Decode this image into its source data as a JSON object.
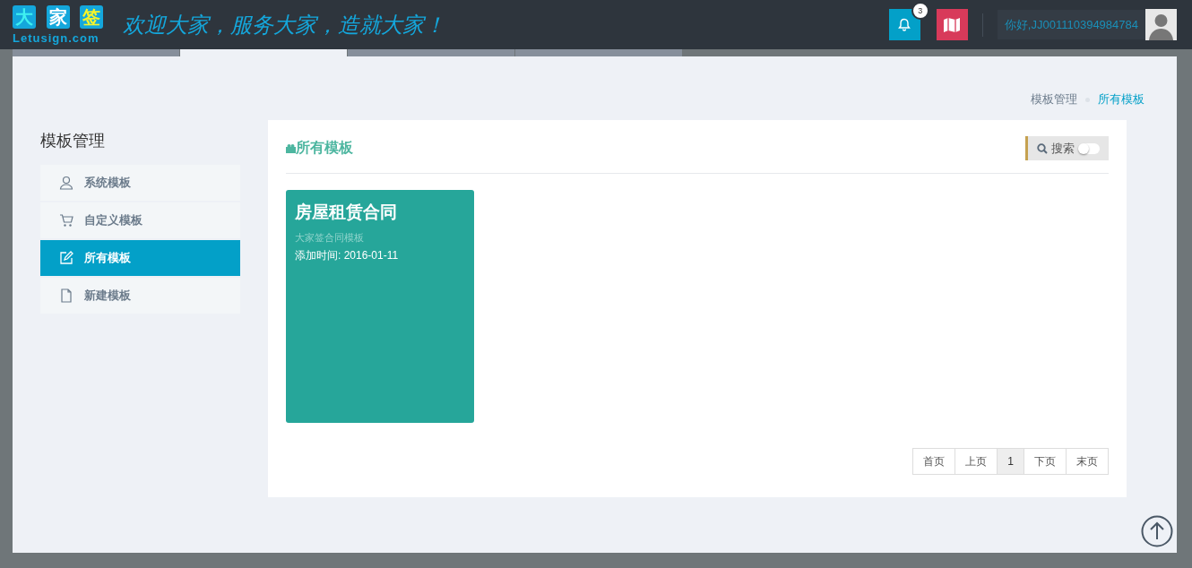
{
  "header": {
    "logo_chars": [
      "大",
      "家",
      "签"
    ],
    "logo_domain": "Letusign.com",
    "slogan": "欢迎大家，服务大家，造就大家！",
    "notification_count": "3",
    "greeting": "你好,JJ001110394984784"
  },
  "top_tabs": [
    {
      "selected": false
    },
    {
      "selected": true
    },
    {
      "selected": false
    },
    {
      "selected": false
    }
  ],
  "breadcrumb": [
    {
      "label": "模板管理",
      "selected": false
    },
    {
      "label": "所有模板",
      "selected": true
    }
  ],
  "sidebar": {
    "title": "模板管理",
    "items": [
      {
        "label": "系统模板",
        "kind": "user",
        "selected": false
      },
      {
        "label": "自定义模板",
        "kind": "cart",
        "selected": false
      },
      {
        "label": "所有模板",
        "kind": "edit",
        "selected": true
      },
      {
        "label": "新建模板",
        "kind": "file",
        "selected": false
      }
    ]
  },
  "panel": {
    "title": "所有模板",
    "search_label": "搜索",
    "search_on": false,
    "cards": [
      {
        "title": "房屋租赁合同",
        "subtitle": "大家签合同模板",
        "added": "添加时间: 2016-01-11"
      }
    ],
    "pagination": [
      {
        "label": "首页",
        "selected": false
      },
      {
        "label": "上页",
        "selected": false
      },
      {
        "label": "1",
        "selected": true
      },
      {
        "label": "下页",
        "selected": false
      },
      {
        "label": "末页",
        "selected": false
      }
    ]
  }
}
